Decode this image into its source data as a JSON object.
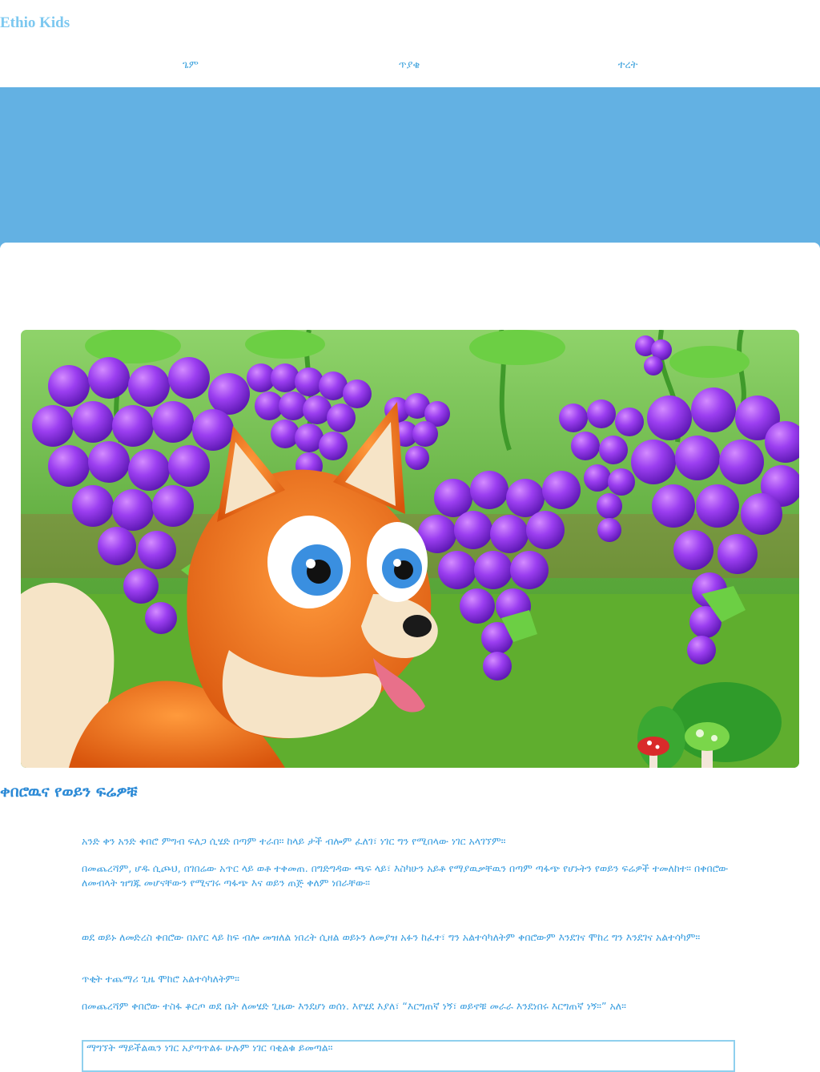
{
  "site": {
    "brand": "Ethio Kids"
  },
  "nav": {
    "items": [
      {
        "label": "ጌም"
      },
      {
        "label": "ጥያቄ"
      },
      {
        "label": "ተረት"
      }
    ]
  },
  "colors": {
    "brand": "#7cc8f0",
    "link": "#4aa8df",
    "banner": "#63b1e3",
    "text": "#3a9ee0",
    "title": "#2c8ad6"
  },
  "hero": {
    "icon": "fox-and-grapes-illustration"
  },
  "story": {
    "title": "ቀበሮዉና የወይን ፍሬዎቹ",
    "paragraphs": [
      "አንድ ቀን አንድ ቀበሮ ምግብ ፍለጋ ሲሄድ በጣም ተራበ። ከላይ ታች ብሎም ፈለገ፣ ነገር ግን የሚበላው ነገር አላገኘም።",
      "በመጨረሻም, ሆዱ ሲጮህ, በገበሬው አጥር ላይ ወቶ ተቀመጠ. በግድግዳው ጫፍ ላይ፣ እስካሁን አይቶ የማያዉቃቸዉን በጣም ጣፋጭ የሆኑትን የወይን ፍሬዎች ተመለከተ። በቀበሮው ለመብላት ዝግጁ መሆናቸውን የሚናገሩ ጣፋጭ እና ወይን ጠጅ ቀለም ነበራቸው።",
      "ወደ ወይኑ ለመድረስ ቀበሮው በአየር ላይ ከፍ ብሎ መዝለል ነበረት ሲዘል ወይኑን ለመያዝ አፉን ከፈተ፣ ግን አልተሳካለትም ቀበሮውም እንደገና ሞከረ ግን እንደገና አልተሳካም።",
      "ጥቂት ተጨማሪ ጊዜ ሞከሮ አልተሳካለትም።",
      "በመጨረሻም ቀበሮው ተስፋ ቆርጦ ወደ ቤት ለመሄድ ጊዜው እንደሆነ ወሰነ. እየሄደ እያለ፣ “እርግጠኛ ነኝ፣ ወይኖቹ መራራ እንደነበሩ እርግጠኛ ነኝ።” አለ።"
    ],
    "moral": "ማግኘት ማይችልዉን ነገር አያጣጥልፉ ሁሉም ነገር ባቂልቁ ይመጣል።"
  }
}
